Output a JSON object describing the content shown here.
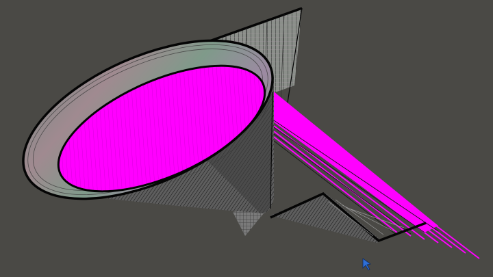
{
  "scene": {
    "background": "#4a4945",
    "colors": {
      "magenta": "#ff00ff",
      "wire_dark": "#1a1a1a",
      "wire_light": "#9a9a9a",
      "cone_outer": "#6e6e6e",
      "rim_band": "#8a9a8a",
      "edge": "#050505"
    },
    "objects": {
      "cone": "wireframe-cone-mesh",
      "back_plane": "wireframe-back-plane",
      "bottom_plane": "wireframe-bottom-plane",
      "ray_fan": "magenta-ray-fan"
    },
    "cursor_icon": "arrow-cursor-icon"
  }
}
